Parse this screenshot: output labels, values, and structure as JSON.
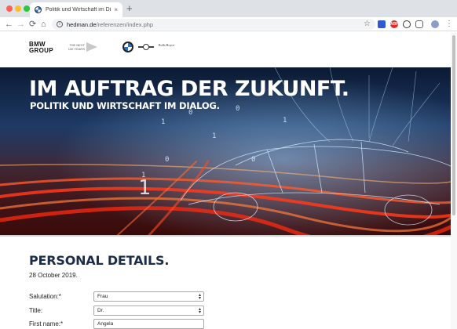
{
  "browser": {
    "tab_title": "Politik und Wirtschaft im Dialog.",
    "tab_close": "×",
    "new_tab": "+",
    "url_host": "hedman.de",
    "url_path": "/referenzen/index.php",
    "back_icon": "←",
    "forward_icon": "→",
    "reload_icon": "⟳",
    "home_icon": "⌂",
    "star_icon": "☆",
    "menu_icon": "⋮",
    "ext_badge": "ABP"
  },
  "header": {
    "bmw_group_line1": "BMW",
    "bmw_group_line2": "GROUP",
    "next100_line1": "THE NEXT",
    "next100_line2": "100 YEARS",
    "rolls_royce": "Rolls-Royce"
  },
  "hero": {
    "title": "IM AUFTRAG DER ZUKUNFT.",
    "subtitle": "POLITIK UND WIRTSCHAFT IM DIALOG."
  },
  "form": {
    "section_title": "PERSONAL DETAILS.",
    "date": "28 October 2019.",
    "fields": [
      {
        "label": "Salutation:*",
        "value": "Frau",
        "type": "select"
      },
      {
        "label": "Title:",
        "value": "Dr.",
        "type": "select"
      },
      {
        "label": "First name:*",
        "value": "Angela",
        "type": "text"
      }
    ]
  },
  "colors": {
    "accent_navy": "#1c2d4a",
    "chrome_bg": "#dee1e6"
  }
}
